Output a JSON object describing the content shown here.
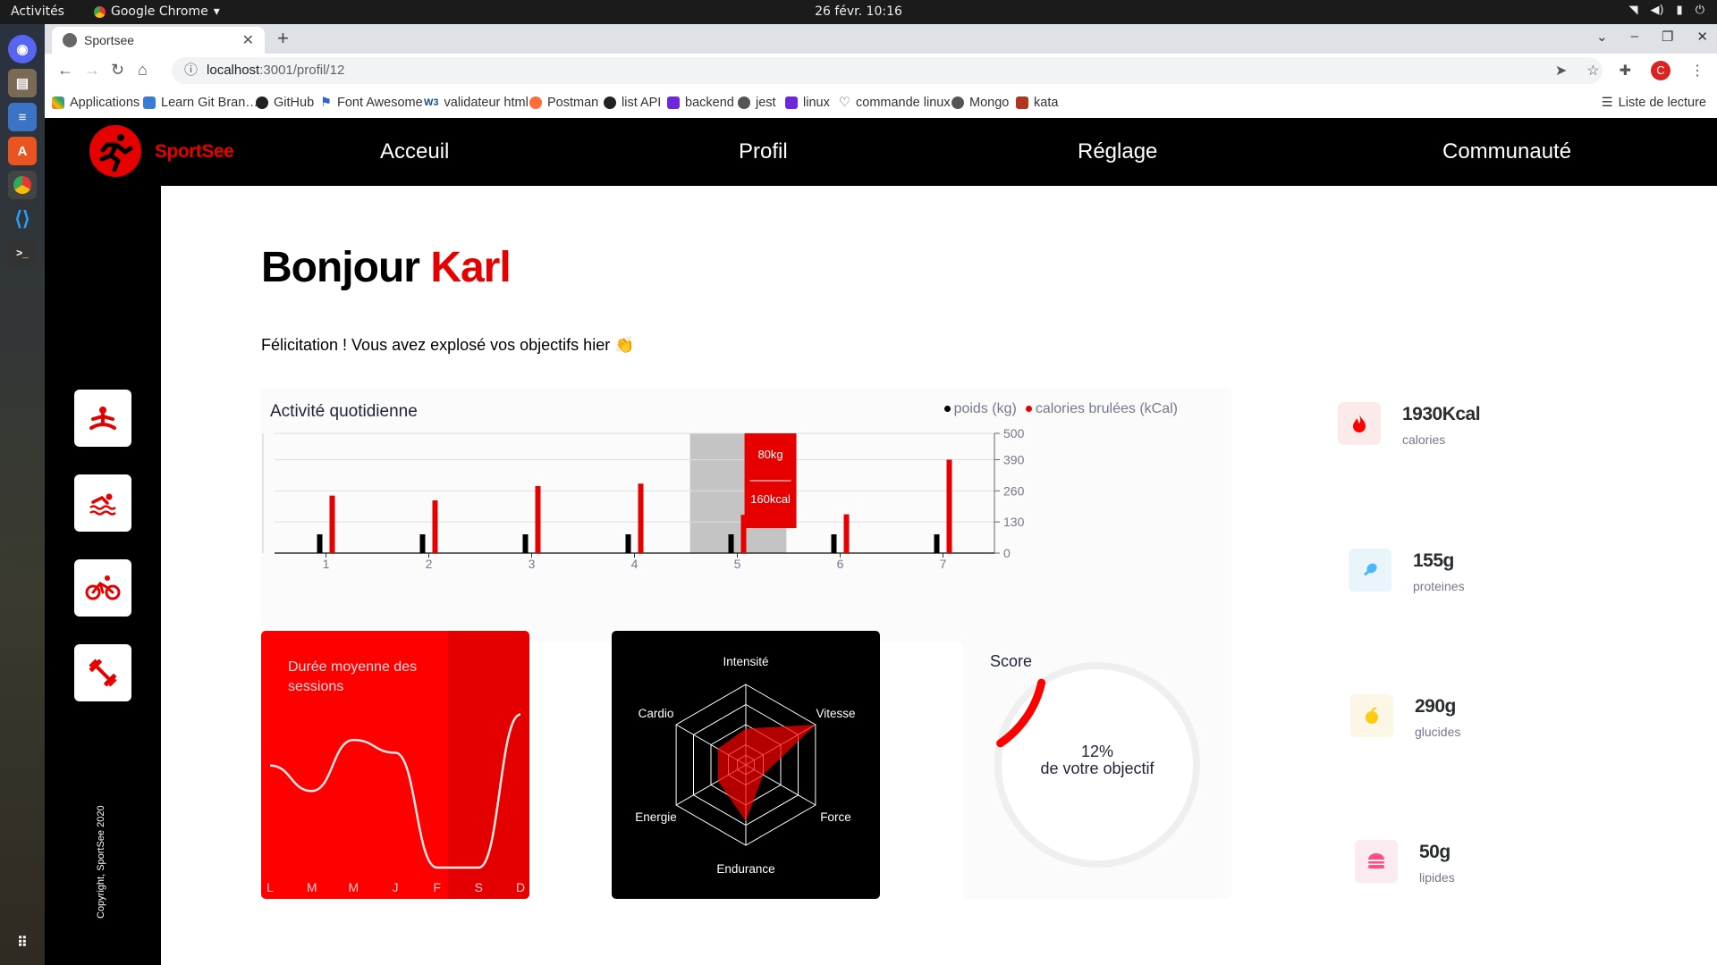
{
  "os": {
    "activities": "Activités",
    "app_name": "Google Chrome",
    "clock": "26 févr.  10:16"
  },
  "browser": {
    "tab_title": "Sportsee",
    "url_host": "localhost",
    "url_path": ":3001/profil/12",
    "bookmarks": [
      "Applications",
      "Learn Git Bran…",
      "GitHub",
      "Font Awesome",
      "validateur html",
      "Postman",
      "list API",
      "backend",
      "jest",
      "linux",
      "commande linux",
      "Mongo",
      "kata"
    ],
    "reading_list": "Liste de lecture",
    "avatar_letter": "C"
  },
  "app": {
    "brand": "SportSee",
    "nav": [
      "Acceuil",
      "Profil",
      "Réglage",
      "Communauté"
    ],
    "copyright": "Copyright, SportSee 2020",
    "greeting": "Bonjour",
    "user_name": "Karl",
    "congrats": "Félicitation ! Vous avez explosé vos objectifs hier 👏",
    "accent": "#e60000",
    "sidebar_icons": [
      "yoga-icon",
      "swimming-icon",
      "cycling-icon",
      "dumbbell-icon"
    ]
  },
  "activity": {
    "title": "Activité quotidienne",
    "legend": [
      "poids (kg)",
      "calories brulées (kCal)"
    ],
    "days": [
      "1",
      "2",
      "3",
      "4",
      "5",
      "6",
      "7"
    ],
    "y_ticks": [
      "0",
      "130",
      "260",
      "390",
      "500"
    ],
    "tooltip_kg": "80kg",
    "tooltip_kcal": "160kcal"
  },
  "duration": {
    "title": "Durée moyenne des sessions",
    "days": [
      "L",
      "M",
      "M",
      "J",
      "F",
      "S",
      "D"
    ]
  },
  "radar": {
    "labels": [
      "Intensité",
      "Vitesse",
      "Force",
      "Endurance",
      "Energie",
      "Cardio"
    ]
  },
  "score": {
    "title": "Score",
    "percent": "12%",
    "caption": "de votre objectif",
    "value": 0.12
  },
  "key_data": [
    {
      "value": "1930Kcal",
      "label": "calories",
      "icon": "fire-icon",
      "bg": "#fbeaea",
      "color": "#ff0000"
    },
    {
      "value": "155g",
      "label": "proteines",
      "icon": "drumstick-icon",
      "bg": "#e9f4fb",
      "color": "#4ab8ff"
    },
    {
      "value": "290g",
      "label": "glucides",
      "icon": "apple-icon",
      "bg": "#fbf6e5",
      "color": "#fdcc0c"
    },
    {
      "value": "50g",
      "label": "lipides",
      "icon": "burger-icon",
      "bg": "#fbeaef",
      "color": "#fd5181"
    }
  ],
  "chart_data": [
    {
      "type": "bar",
      "title": "Activité quotidienne",
      "categories": [
        "1",
        "2",
        "3",
        "4",
        "5",
        "6",
        "7"
      ],
      "series": [
        {
          "name": "poids (kg)",
          "values": [
            80,
            80,
            80,
            80,
            80,
            80,
            80
          ]
        },
        {
          "name": "calories brulées (kCal)",
          "values": [
            240,
            220,
            280,
            290,
            160,
            162,
            390
          ]
        }
      ],
      "ylim": [
        0,
        500
      ],
      "y_ticks": [
        0,
        130,
        260,
        390,
        500
      ],
      "legend": "top-right",
      "grid": true,
      "highlighted_category": "5",
      "tooltip": {
        "category": "5",
        "weight": "80kg",
        "calories": "160kcal"
      }
    },
    {
      "type": "line",
      "title": "Durée moyenne des sessions",
      "categories": [
        "L",
        "M",
        "M",
        "J",
        "F",
        "S",
        "D"
      ],
      "values": [
        40,
        30,
        50,
        45,
        0,
        0,
        60
      ],
      "ylim": [
        0,
        70
      ]
    },
    {
      "type": "radar",
      "categories": [
        "Intensité",
        "Vitesse",
        "Force",
        "Endurance",
        "Energie",
        "Cardio"
      ],
      "values": [
        90,
        200,
        50,
        140,
        80,
        80
      ],
      "rlim": [
        0,
        200
      ]
    },
    {
      "type": "pie",
      "title": "Score",
      "values": [
        12,
        88
      ],
      "categories": [
        "score",
        "reste"
      ]
    }
  ]
}
